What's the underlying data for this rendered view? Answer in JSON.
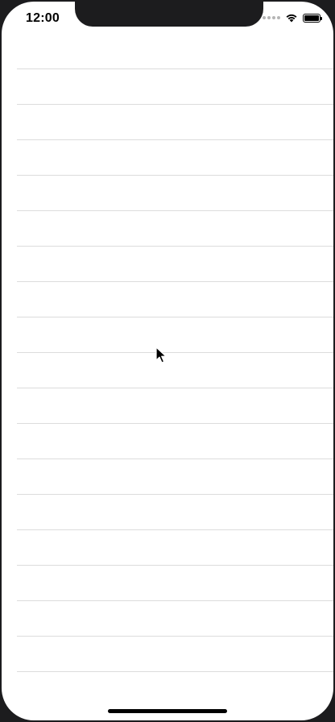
{
  "status_bar": {
    "time": "12:00",
    "icons": [
      "cellular-signal-icon",
      "wifi-icon",
      "battery-icon"
    ],
    "battery_level": 1.0
  },
  "list": {
    "rows": [
      "",
      "",
      "",
      "",
      "",
      "",
      "",
      "",
      "",
      "",
      "",
      "",
      "",
      "",
      "",
      "",
      "",
      ""
    ]
  },
  "colors": {
    "background": "#ffffff",
    "separator": "#dcdcdc",
    "bezel": "#1c1c1e"
  }
}
